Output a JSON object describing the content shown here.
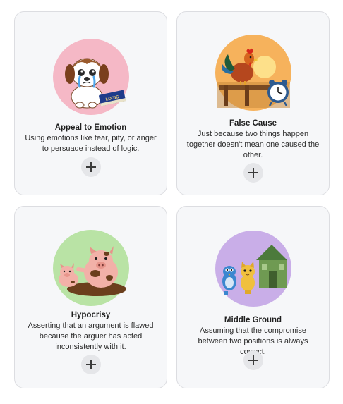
{
  "cards": [
    {
      "title": "Appeal to Emotion",
      "description": "Using emotions like fear, pity, or anger to persuade instead of logic.",
      "illustration": "crying-puppy-with-logic-book",
      "book_label": "LOGIC",
      "circle_color": "#f5b8c6",
      "add_icon": "plus-icon"
    },
    {
      "title": "False Cause",
      "description": "Just because two things happen together doesn't mean one caused the other.",
      "illustration": "rooster-at-sunrise-with-alarm-clock",
      "circle_color": "#f6b25c",
      "add_icon": "plus-icon"
    },
    {
      "title": "Hypocrisy",
      "description": "Asserting that an argument is flawed because the arguer has acted inconsistently with it.",
      "illustration": "muddy-pig-pointing-at-piglet",
      "circle_color": "#b9e3a5",
      "add_icon": "plus-icon"
    },
    {
      "title": "Middle Ground",
      "description": "Assuming that the compromise between two positions is always correct.",
      "illustration": "bird-and-cat-by-house",
      "circle_color": "#c9aee8",
      "add_icon": "plus-icon"
    }
  ]
}
